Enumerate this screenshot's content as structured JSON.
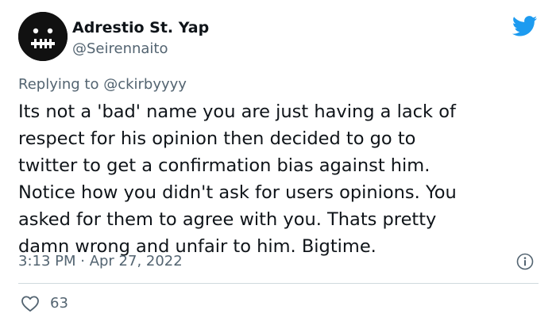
{
  "author": {
    "display_name": "Adrestio St. Yap",
    "handle": "@Seirennaito"
  },
  "reply": {
    "prefix": "Replying to ",
    "mention": "@ckirbyyyy"
  },
  "tweet": {
    "text": "Its not a 'bad' name you are just having a lack of\nrespect for his opinion then decided to go to\ntwitter to get a confirmation bias against him.\nNotice how you didn't ask for users opinions. You\nasked for them to agree with you. Thats pretty\ndamn wrong and unfair to him. Bigtime.",
    "timestamp": "3:13 PM · Apr 27, 2022"
  },
  "stats": {
    "likes": "63"
  },
  "colors": {
    "twitter_blue": "#1d9bf0",
    "secondary_text": "#536471",
    "primary_text": "#0f1419",
    "divider": "#cfd9de"
  },
  "icons": {
    "logo": "twitter-bird-icon",
    "info": "info-icon",
    "like": "heart-outline-icon"
  }
}
